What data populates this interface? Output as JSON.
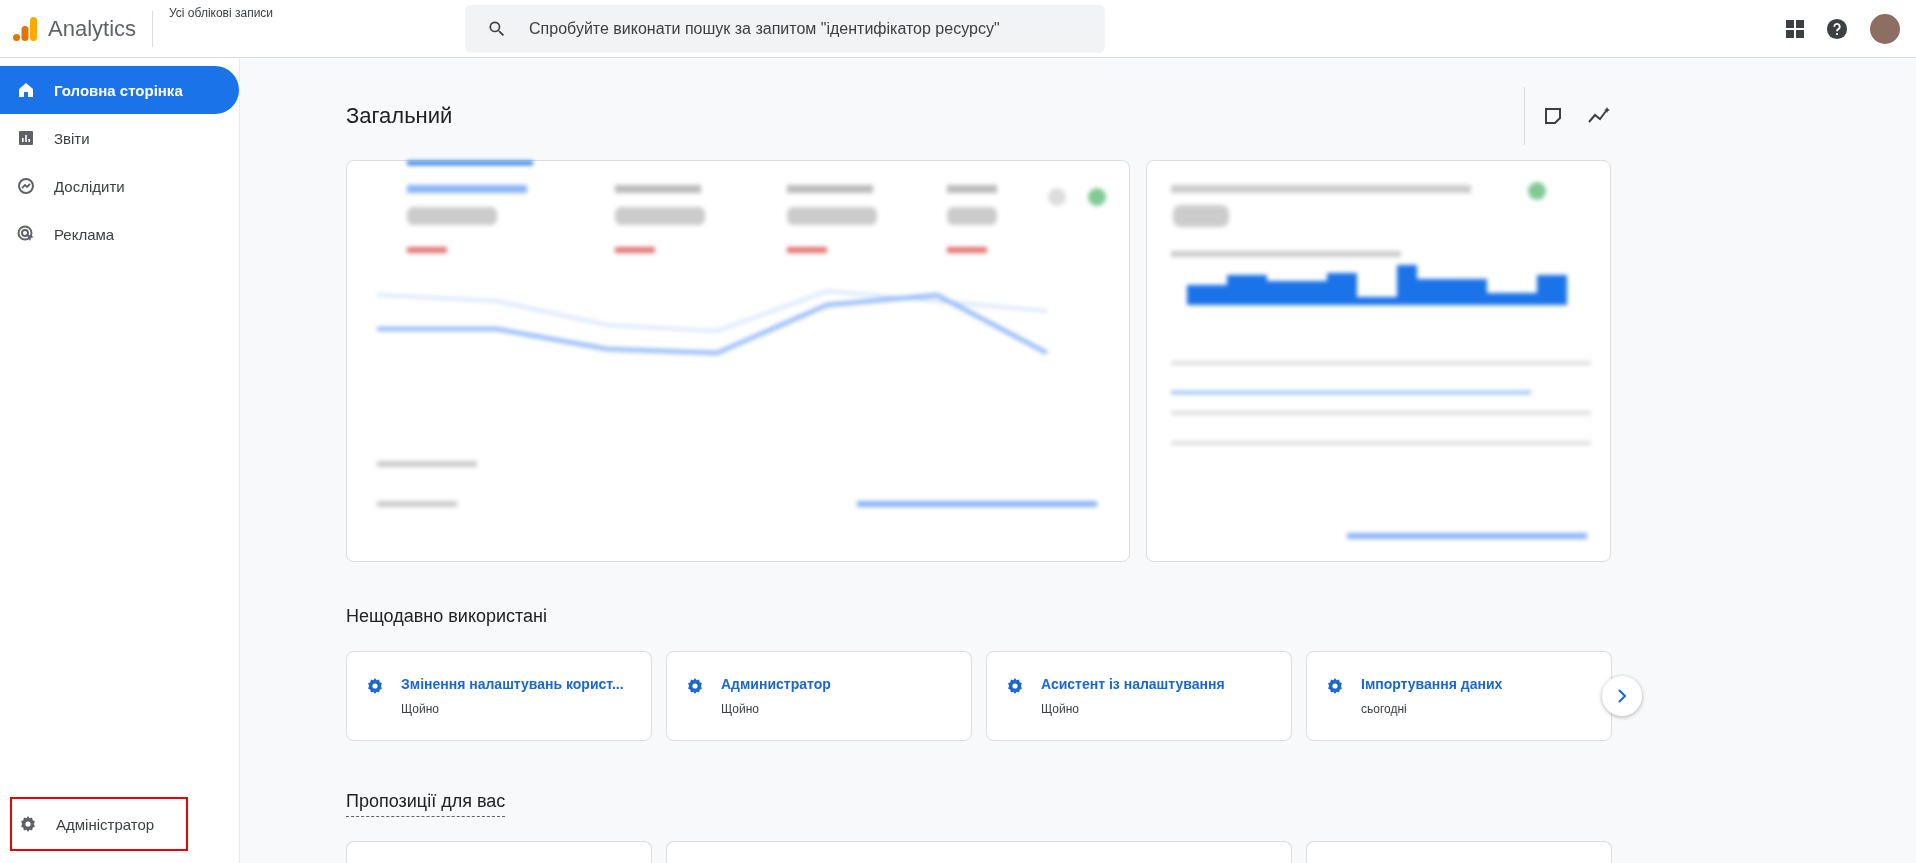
{
  "app": {
    "name": "Analytics",
    "account": "Усі облікові записи"
  },
  "search": {
    "placeholder": "Спробуйте виконати пошук за запитом \"ідентифікатор ресурсу\""
  },
  "sidebar": {
    "items": [
      {
        "kind": "home",
        "label": "Головна сторінка",
        "selected": true
      },
      {
        "kind": "reports",
        "label": "Звіти",
        "selected": false
      },
      {
        "kind": "explore",
        "label": "Дослідити",
        "selected": false
      },
      {
        "kind": "ads",
        "label": "Реклама",
        "selected": false
      }
    ],
    "footer": {
      "kind": "admin",
      "label": "Адміністратор",
      "highlighted": true
    }
  },
  "overview": {
    "title": "Загальний"
  },
  "recent": {
    "title": "Нещодавно використані",
    "items": [
      {
        "title": "Змінення налаштувань корист...",
        "time": "Щойно"
      },
      {
        "title": "Администратор",
        "time": "Щойно"
      },
      {
        "title": "Асистент із налаштування",
        "time": "Щойно"
      },
      {
        "title": "Імпортування даних",
        "time": "сьогодні"
      }
    ]
  },
  "suggestions": {
    "title": "Пропозиції для вас"
  }
}
